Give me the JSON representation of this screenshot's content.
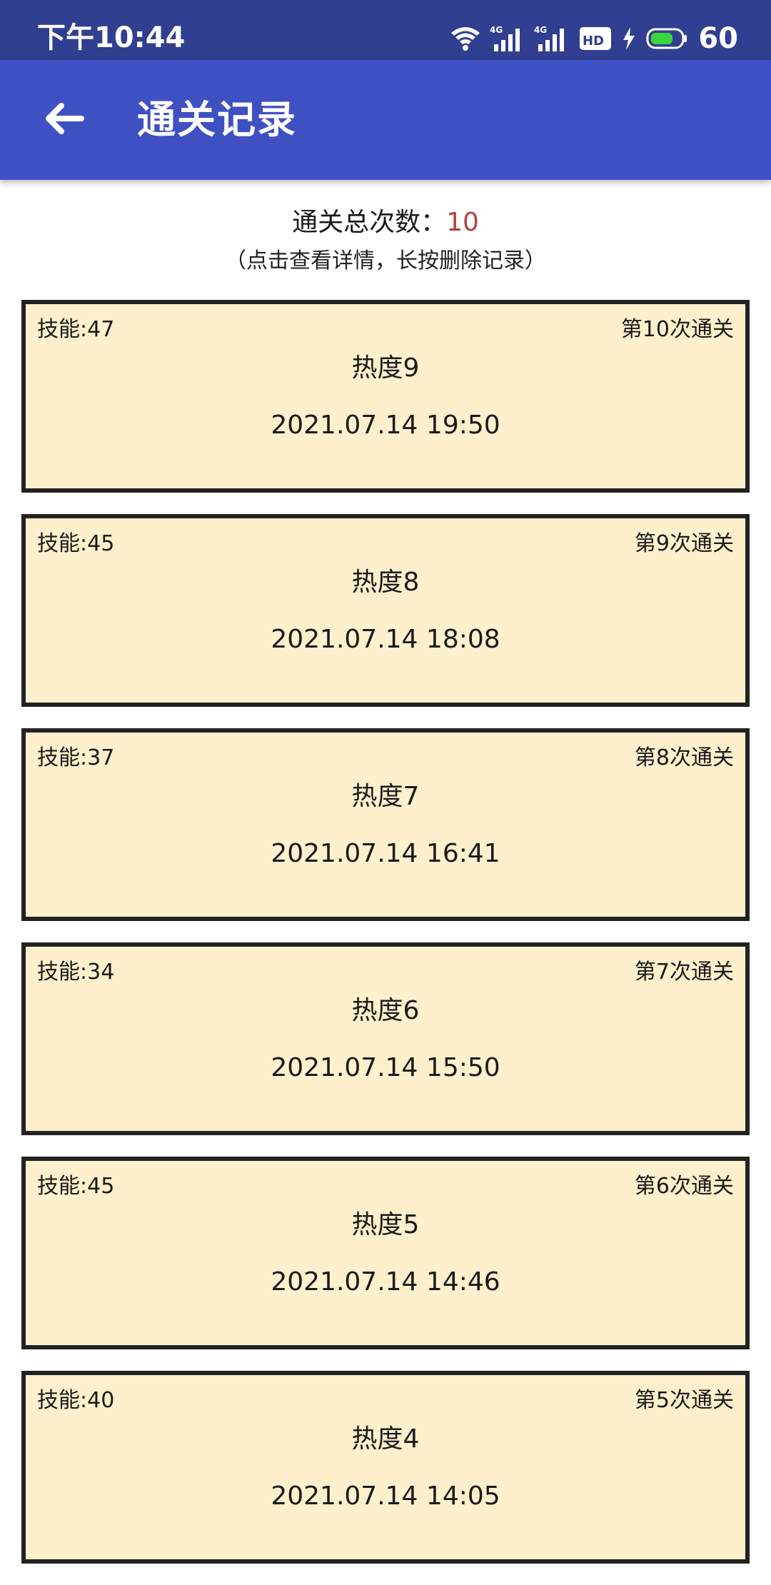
{
  "status_bar": {
    "time": "下午10:44",
    "battery_level": "60",
    "icons": [
      "wifi-icon",
      "signal-4g-icon",
      "signal-4g-icon",
      "hd-icon",
      "charging-icon",
      "battery-icon"
    ]
  },
  "app_bar": {
    "title": "通关记录",
    "back_icon": "arrow-left-icon"
  },
  "summary": {
    "label": "通关总次数：",
    "count": "10",
    "count_color": "#b2433a",
    "hint": "（点击查看详情，长按删除记录）"
  },
  "colors": {
    "status_bar": "#303f90",
    "app_bar": "#3f51c2",
    "card_background": "#fef0cc",
    "card_border": "#222222"
  },
  "records": [
    {
      "skill": "技能:47",
      "nth": "第10次通关",
      "heat": "热度9",
      "time": "2021.07.14 19:50"
    },
    {
      "skill": "技能:45",
      "nth": "第9次通关",
      "heat": "热度8",
      "time": "2021.07.14 18:08"
    },
    {
      "skill": "技能:37",
      "nth": "第8次通关",
      "heat": "热度7",
      "time": "2021.07.14 16:41"
    },
    {
      "skill": "技能:34",
      "nth": "第7次通关",
      "heat": "热度6",
      "time": "2021.07.14 15:50"
    },
    {
      "skill": "技能:45",
      "nth": "第6次通关",
      "heat": "热度5",
      "time": "2021.07.14 14:46"
    },
    {
      "skill": "技能:40",
      "nth": "第5次通关",
      "heat": "热度4",
      "time": "2021.07.14 14:05"
    }
  ]
}
